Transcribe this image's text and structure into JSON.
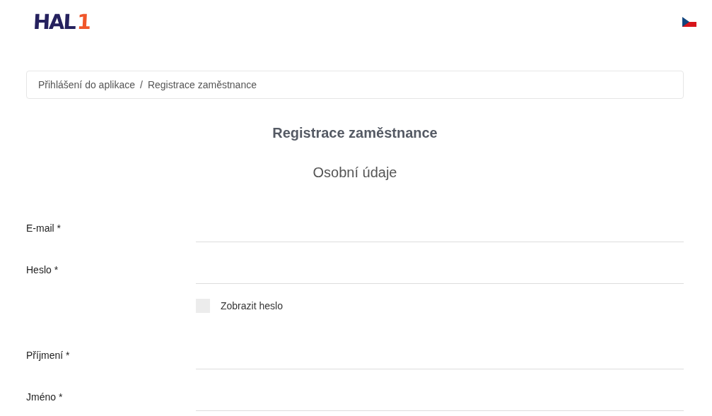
{
  "header": {
    "logo": {
      "main": "HAL",
      "accent": "1"
    },
    "language_flag": {
      "kind": "czech"
    }
  },
  "breadcrumb": [
    "Přihlášení do aplikace",
    "Registrace zaměstnance"
  ],
  "breadcrumb_separator": "/",
  "title": "Registrace zaměstnance",
  "section_title": "Osobní údaje",
  "fields": [
    {
      "kind": "text",
      "label": "E-mail *"
    },
    {
      "kind": "text",
      "label": "Heslo *"
    },
    {
      "kind": "checkbox",
      "label": "Zobrazit heslo",
      "checked": false
    },
    {
      "kind": "text",
      "label": "Příjmení *"
    },
    {
      "kind": "text",
      "label": "Jméno *"
    }
  ]
}
